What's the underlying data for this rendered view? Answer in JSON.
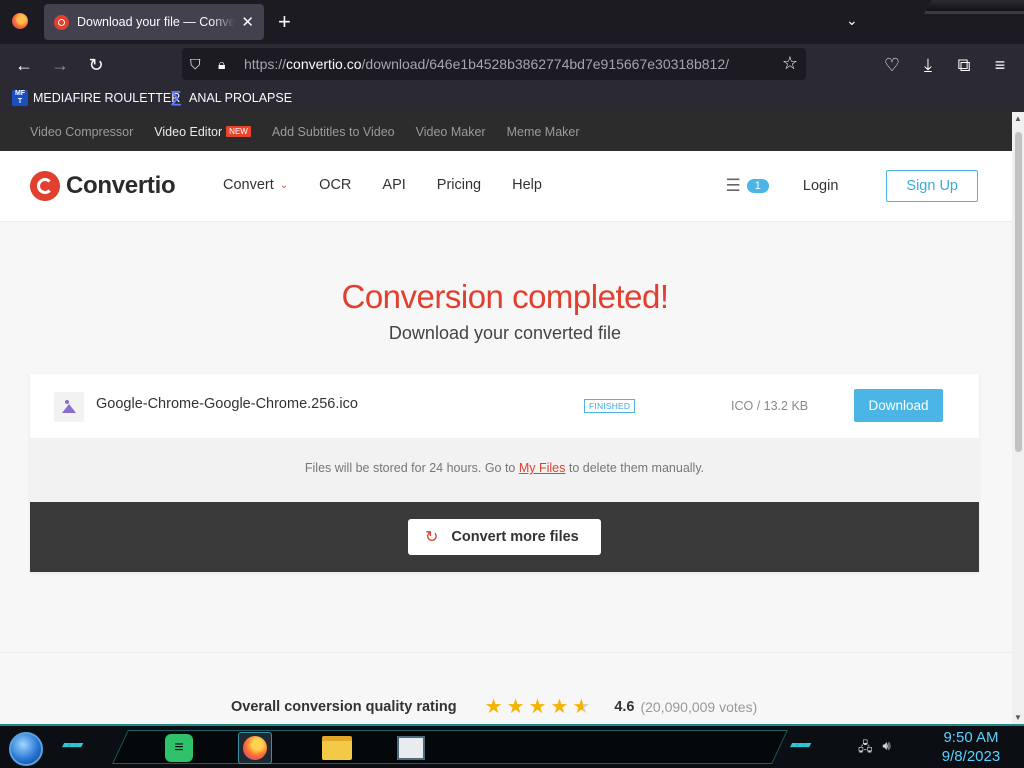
{
  "browser": {
    "tab": {
      "title": "Download your file — Convertio"
    },
    "address": {
      "scheme": "https://",
      "host": "convertio.co",
      "path": "/download/646e1b4528b3862774bd7e915667e30318b812/"
    },
    "bookmarks": [
      {
        "label": "MEDIAFIRE ROULETTER",
        "icon_text": "MF T"
      },
      {
        "label": "ANAL PROLAPSE"
      }
    ]
  },
  "topstrip": {
    "items": [
      {
        "label": "Video Compressor"
      },
      {
        "label": "Video Editor",
        "badge": "NEW"
      },
      {
        "label": "Add Subtitles to Video"
      },
      {
        "label": "Video Maker"
      },
      {
        "label": "Meme Maker"
      }
    ]
  },
  "header": {
    "logo_text": "Convertio",
    "nav": [
      "Convert",
      "OCR",
      "API",
      "Pricing",
      "Help"
    ],
    "file_count": "1",
    "login": "Login",
    "signup": "Sign Up"
  },
  "main": {
    "title": "Conversion completed!",
    "subtitle": "Download your converted file",
    "file": {
      "name": "Google-Chrome-Google-Chrome.256.ico",
      "status": "FINISHED",
      "meta": "ICO / 13.2 KB",
      "download_label": "Download"
    },
    "notice": {
      "before": "Files will be stored for 24 hours. Go to ",
      "link": "My Files",
      "after": " to delete them manually."
    },
    "convert_more": "Convert more files"
  },
  "rating": {
    "label": "Overall conversion quality rating",
    "score": "4.6",
    "votes": "(20,090,009 votes)",
    "stars_value": 4.6
  },
  "taskbar": {
    "clock_time": "9:50 AM",
    "clock_date": "9/8/2023"
  },
  "colors": {
    "accent_red": "#e1402e",
    "accent_blue": "#4bb5e6",
    "star": "#f5b301"
  }
}
